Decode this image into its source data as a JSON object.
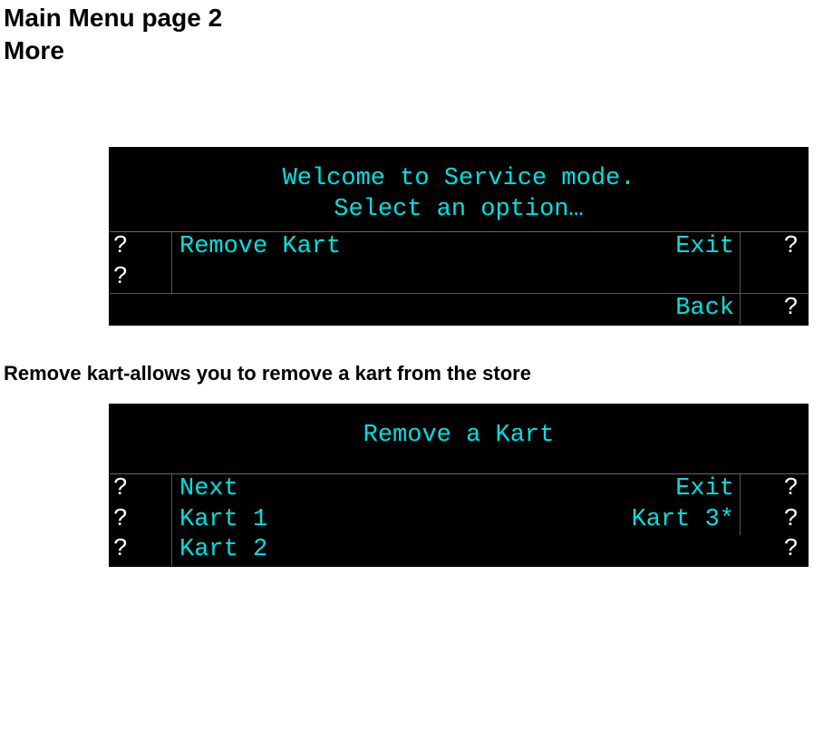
{
  "heading": {
    "line1": "Main Menu page 2",
    "line2": "More"
  },
  "panel1": {
    "header1": "Welcome to Service mode.",
    "header2": "Select an option…",
    "rows": [
      {
        "qL": "?",
        "left": "Remove Kart",
        "right": "Exit",
        "qR": "?"
      },
      {
        "qL": "?",
        "left": "",
        "right": "",
        "qR": ""
      },
      {
        "qL": "",
        "left": "",
        "right": "Back",
        "qR": "?"
      }
    ]
  },
  "caption1": "Remove kart-allows you to remove a kart from the store",
  "panel2": {
    "header1": "Remove a Kart",
    "rows": [
      {
        "qL": "?",
        "left": "Next",
        "right": "Exit",
        "qR": "?"
      },
      {
        "qL": "?",
        "left": "Kart 1",
        "right": "Kart 3*",
        "qR": "?"
      },
      {
        "qL": "?",
        "left": "Kart 2",
        "right": "",
        "qR": "?"
      }
    ]
  }
}
